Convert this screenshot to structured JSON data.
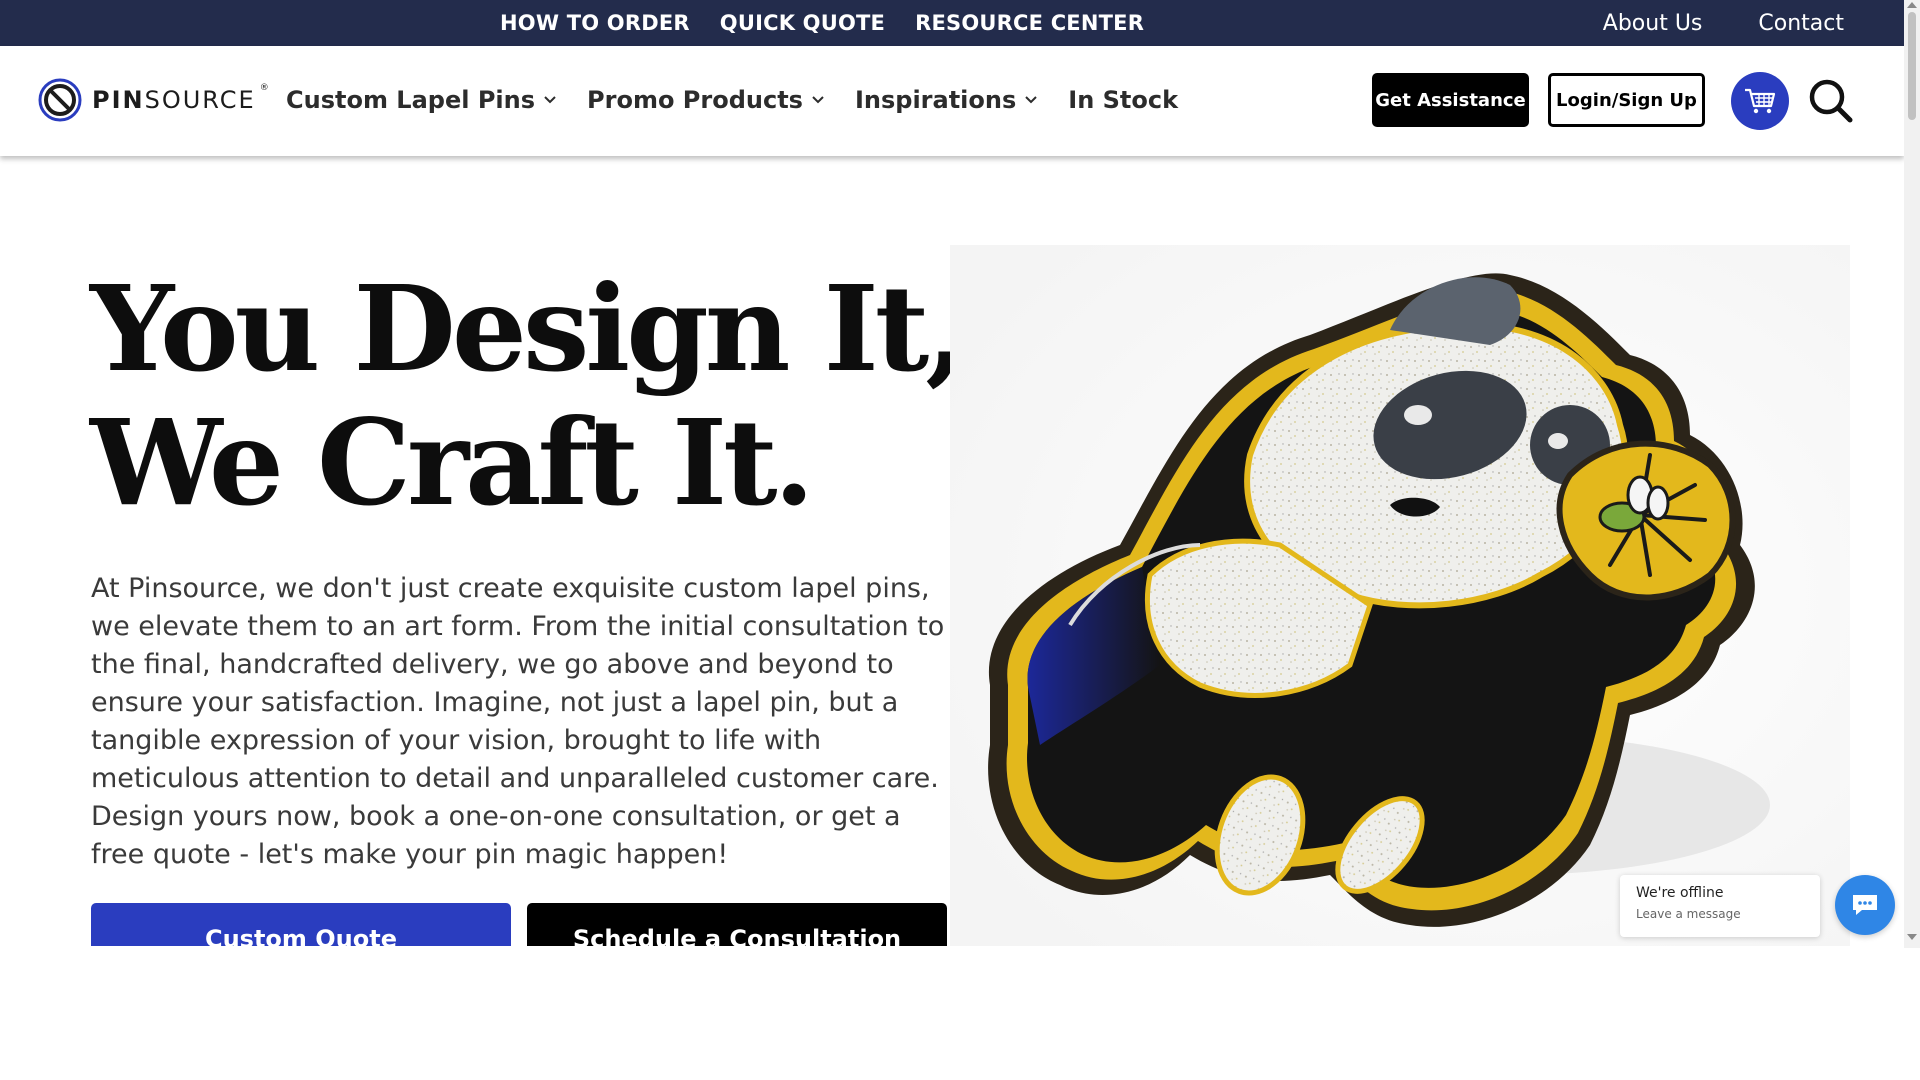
{
  "topbar": {
    "links": [
      "HOW TO ORDER",
      "QUICK QUOTE",
      "RESOURCE CENTER"
    ],
    "right_links": [
      "About Us",
      "Contact"
    ]
  },
  "nav": {
    "logo_bold": "PIN",
    "logo_rest": "SOURCE",
    "logo_reg": "®",
    "menu": [
      {
        "label": "Custom Lapel Pins",
        "dropdown": true
      },
      {
        "label": "Promo Products",
        "dropdown": true
      },
      {
        "label": "Inspirations",
        "dropdown": true
      },
      {
        "label": "In Stock",
        "dropdown": false
      }
    ],
    "assist_label": "Get Assistance",
    "login_label": "Login/Sign Up",
    "cart_icon": "cart-icon",
    "search_icon": "search-icon"
  },
  "hero": {
    "title_line1": "You Design It,",
    "title_line2": "We Craft It.",
    "body": "At Pinsource, we don't just create exquisite custom lapel pins, we elevate them to an art form. From the initial consultation to the final, handcrafted delivery, we go above and beyond to ensure your satisfaction. Imagine, not just a lapel pin, but a tangible expression of your vision, brought to life with meticulous attention to detail and unparalleled customer care. Design yours now, book a one-on-one consultation, or get a free quote - let's make your pin magic happen!",
    "quote_button": "Custom Quote",
    "consult_button": "Schedule a Consultation"
  },
  "chat": {
    "status": "We're offline",
    "subtitle": "Leave a message"
  },
  "colors": {
    "topbar_bg": "#232c4c",
    "accent_blue": "#2a3dbf",
    "chat_blue": "#2f86e6",
    "pin_gold": "#e3b81c"
  }
}
